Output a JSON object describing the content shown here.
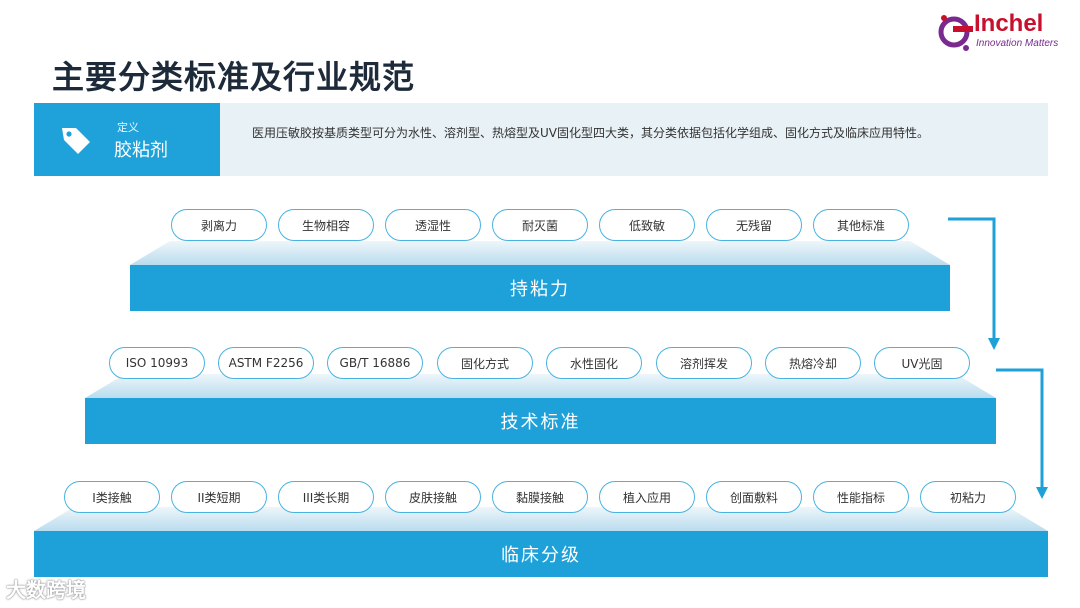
{
  "title": "主要分类标准及行业规范",
  "logo": {
    "name": "Inchel",
    "tagline": "Innovation Matters",
    "colors": {
      "red": "#c8102e",
      "purple": "#7a2a8f"
    }
  },
  "definition": {
    "small_label": "定义",
    "term": "胶粘剂",
    "text": "医用压敏胶按基质类型可分为水性、溶剂型、热熔型及UV固化型四大类，其分类依据包括化学组成、固化方式及临床应用特性。",
    "icon": "tag-icon"
  },
  "tiers": [
    {
      "label": "持粘力",
      "pills": [
        {
          "text": "剥离力"
        },
        {
          "text": "生物相容"
        },
        {
          "text": "透湿性"
        },
        {
          "text": "耐灭菌"
        },
        {
          "text": "低致敏"
        },
        {
          "text": "无残留"
        },
        {
          "text": "其他标准"
        }
      ]
    },
    {
      "label": "技术标准",
      "pills": [
        {
          "text": "ISO 10993"
        },
        {
          "text": "ASTM F2256"
        },
        {
          "text": "GB/T 16886"
        },
        {
          "text": "固化方式"
        },
        {
          "text": "水性固化"
        },
        {
          "text": "溶剂挥发"
        },
        {
          "text": "热熔冷却"
        },
        {
          "text": "UV光固"
        }
      ]
    },
    {
      "label": "临床分级",
      "pills": [
        {
          "text": "I类接触"
        },
        {
          "text": "II类短期"
        },
        {
          "text": "III类长期"
        },
        {
          "text": "皮肤接触"
        },
        {
          "text": "黏膜接触"
        },
        {
          "text": "植入应用"
        },
        {
          "text": "创面敷料"
        },
        {
          "text": "性能指标"
        },
        {
          "text": "初粘力"
        }
      ]
    }
  ],
  "watermark": "大数跨境",
  "colors": {
    "accent": "#1ea1d9",
    "pill_border": "#49b2e0",
    "def_bg": "#e8f1f6"
  }
}
